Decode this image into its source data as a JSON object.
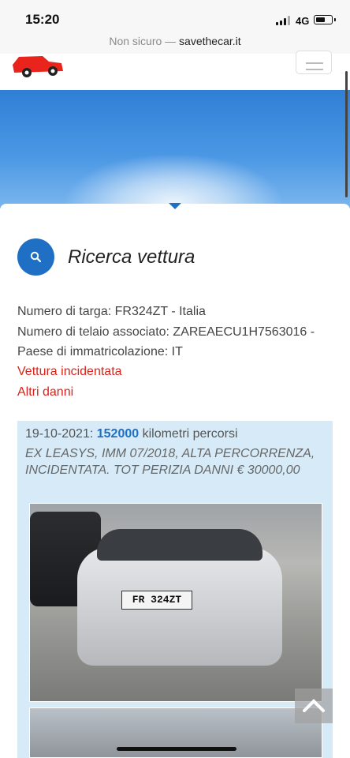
{
  "status_bar": {
    "time": "15:20",
    "network": "4G",
    "battery_level": 0.65
  },
  "browser": {
    "insecure_label": "Non sicuro",
    "separator": "—",
    "domain": "savethecar.it"
  },
  "colors": {
    "accent": "#1f6fc4",
    "alert": "#d9231c",
    "record_bg": "#d6ebf7"
  },
  "search": {
    "title": "Ricerca vettura",
    "icon": "search-icon"
  },
  "vehicle": {
    "plate_line": "Numero di targa: FR324ZT - Italia",
    "vin_line": "Numero di telaio associato: ZAREAECU1H7563016 -",
    "country_line": "Paese di immatricolazione: IT",
    "flag_damaged": "Vettura incidentata",
    "flag_other": "Altri danni"
  },
  "record": {
    "date": "19-10-2021",
    "colon": ":",
    "km": "152000",
    "km_suffix": "kilometri percorsi",
    "description": "EX LEASYS, IMM 07/2018, ALTA PERCORRENZA, INCIDENTATA. TOT PERIZIA DANNI € 30000,00",
    "plate_in_photo": "FR 324ZT"
  }
}
